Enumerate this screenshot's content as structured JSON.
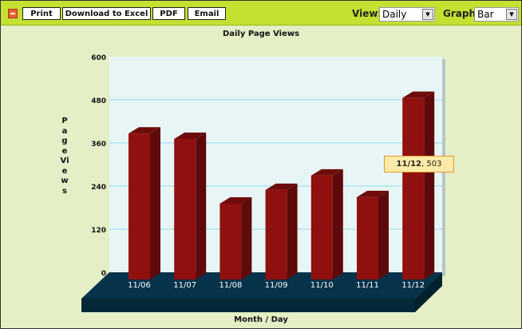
{
  "toolbar": {
    "print": "Print",
    "excel": "Download to Excel",
    "pdf": "PDF",
    "email": "Email",
    "view_label": "View:",
    "view_value": "Daily",
    "graph_label": "Graph:",
    "graph_value": "Bar"
  },
  "tooltip": {
    "category": "11/12",
    "value": "503"
  },
  "chart_data": {
    "type": "bar",
    "title": "Daily Page Views",
    "xlabel": "Month / Day",
    "ylabel": "Page Views",
    "categories": [
      "11/06",
      "11/07",
      "11/08",
      "11/09",
      "11/10",
      "11/11",
      "11/12"
    ],
    "values": [
      404,
      389,
      209,
      247,
      287,
      227,
      503
    ],
    "ylim": [
      0,
      600
    ],
    "yticks": [
      "0",
      "120",
      "240",
      "360",
      "480",
      "600"
    ],
    "grid": true,
    "colors": {
      "bar": "#901010",
      "bar_side": "#5e0a0a",
      "bar_top": "#6e0c0c",
      "floor": "#06324a",
      "plot_bg": "#e8f5f5",
      "grid": "#8fe0ea"
    }
  }
}
